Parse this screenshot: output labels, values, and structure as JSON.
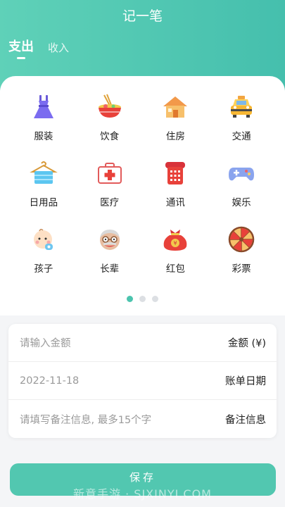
{
  "header": {
    "title": "记一笔",
    "tabs": [
      {
        "label": "支出"
      },
      {
        "label": "收入"
      }
    ]
  },
  "categories": [
    {
      "label": "服装",
      "icon": "dress-icon"
    },
    {
      "label": "饮食",
      "icon": "noodle-bowl-icon"
    },
    {
      "label": "住房",
      "icon": "house-icon"
    },
    {
      "label": "交通",
      "icon": "taxi-icon"
    },
    {
      "label": "日用品",
      "icon": "towel-hanger-icon"
    },
    {
      "label": "医疗",
      "icon": "medical-kit-icon"
    },
    {
      "label": "通讯",
      "icon": "telephone-icon"
    },
    {
      "label": "娱乐",
      "icon": "gamepad-icon"
    },
    {
      "label": "孩子",
      "icon": "baby-icon"
    },
    {
      "label": "长辈",
      "icon": "elder-icon"
    },
    {
      "label": "红包",
      "icon": "red-envelope-icon"
    },
    {
      "label": "彩票",
      "icon": "lottery-wheel-icon"
    }
  ],
  "pager": {
    "pages": 3,
    "active": 1
  },
  "form": {
    "amount": {
      "placeholder": "请输入金额",
      "label": "金额 (¥)"
    },
    "date": {
      "value": "2022-11-18",
      "label": "账单日期"
    },
    "note": {
      "placeholder": "请填写备注信息, 最多15个字",
      "label": "备注信息"
    }
  },
  "save_label": "保存",
  "watermark": "新意手游 · SJXINYI.COM",
  "colors": {
    "accent": "#52c7b0",
    "header_start": "#5fd1b8",
    "header_end": "#45bfad"
  }
}
